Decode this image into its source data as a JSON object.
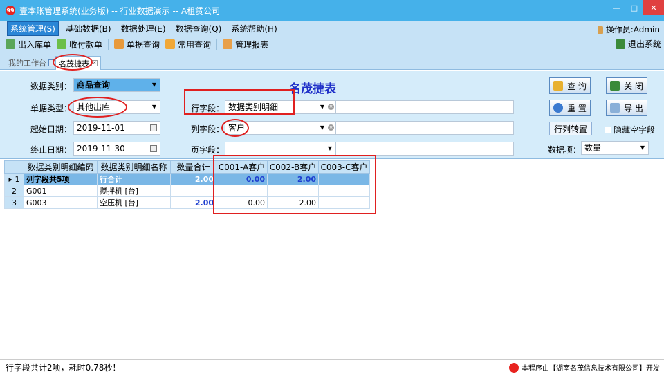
{
  "window": {
    "title": "壹本账管理系统(业务版) -- 行业数据演示 -- A租赁公司",
    "logo": "99"
  },
  "menu": {
    "items": [
      "系统管理(S)",
      "基础数据(B)",
      "数据处理(E)",
      "数据查询(Q)",
      "系统帮助(H)"
    ],
    "operator": "操作员:Admin"
  },
  "toolbar": {
    "items": [
      "出入库单",
      "收付款单",
      "单据查询",
      "常用查询",
      "管理报表"
    ],
    "exit": "退出系统"
  },
  "tabs": {
    "home": "我的工作台",
    "active": "名茂捷表"
  },
  "form": {
    "title": "名茂捷表",
    "data_type_label": "数据类别：",
    "data_type_value": "商品查询",
    "doc_type_label": "单据类型：",
    "doc_type_value": "其他出库",
    "start_label": "起始日期：",
    "start_value": "2019-11-01",
    "end_label": "终止日期：",
    "end_value": "2019-11-30",
    "row_field_label": "行字段：",
    "row_field_value": "数据类别明细",
    "col_field_label": "列字段：",
    "col_field_value": "客户",
    "page_field_label": "页字段：",
    "page_field_value": "",
    "query_btn": "查 询",
    "close_btn": "关 闭",
    "reset_btn": "重 置",
    "export_btn": "导 出",
    "transpose_btn": "行列转置",
    "hide_empty": "隐藏空字段",
    "data_item_label": "数据项：",
    "data_item_value": "数量"
  },
  "grid": {
    "columns": [
      "数据类别明细编码",
      "数据类别明细名称",
      "数量合计",
      "C001-A客户",
      "C002-B客户",
      "C003-C客户"
    ],
    "rows": [
      {
        "rn": "1",
        "code": "列字段共5项",
        "name": "行合计",
        "total": "2.00",
        "c1": "0.00",
        "c2": "2.00",
        "c3": ""
      },
      {
        "rn": "2",
        "code": "G001",
        "name": "搅拌机 [台]",
        "total": "",
        "c1": "",
        "c2": "",
        "c3": ""
      },
      {
        "rn": "3",
        "code": "G003",
        "name": "空压机 [台]",
        "total": "2.00",
        "c1": "0.00",
        "c2": "2.00",
        "c3": ""
      }
    ]
  },
  "status": {
    "text": "行字段共计2项，耗时0.78秒！",
    "credit": "本程序由【湖南名茂信息技术有限公司】开发"
  }
}
